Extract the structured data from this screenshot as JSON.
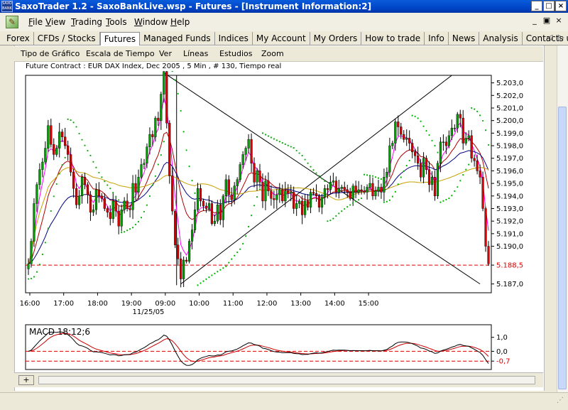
{
  "window": {
    "title": "SaxoTrader 1.2 - SaxoBankLive.wsp - Futures - [Instrument Information:2]",
    "app_icon_text": [
      "SAXO",
      "BANK"
    ],
    "controls": {
      "minimize": "_",
      "maximize": "□",
      "close": "×"
    }
  },
  "menubar": {
    "items": [
      {
        "label": "File",
        "accel": "F"
      },
      {
        "label": "View",
        "accel": "V"
      },
      {
        "label": "Trading",
        "accel": "T"
      },
      {
        "label": "Tools",
        "accel": "T"
      },
      {
        "label": "Window",
        "accel": "W"
      },
      {
        "label": "Help",
        "accel": "H"
      }
    ],
    "doc_controls": {
      "minimize": "_",
      "restore": "▣",
      "close": "×"
    }
  },
  "nav_tabs": [
    "Forex",
    "CFDs / Stocks",
    "Futures",
    "Managed Funds",
    "Indices",
    "My Account",
    "My Orders",
    "How to trade",
    "Info",
    "News",
    "Analysis",
    "Contacts us"
  ],
  "nav_active": "Futures",
  "nav_scroll": {
    "left": "◁",
    "right": "▷"
  },
  "chart_toolbar": [
    "Tipo de Gráfico",
    "Escala de Tiempo",
    "Ver",
    "Líneas",
    "Estudios",
    "Zoom"
  ],
  "chart_title": "Future Contract : EUR DAX Index, Dec 2005 , 5 Min , # 130, Tiempo real",
  "colors": {
    "bull": "#00A000",
    "bear": "#DD0000",
    "magenta": "#FF00FF",
    "red_ma": "#B00000",
    "blue_ma": "#000080",
    "gold_ma": "#C8A000",
    "sar": "#00B000",
    "ref_line": "#DD0000",
    "macd": "#000000",
    "signal": "#CC0000"
  },
  "chart_data": {
    "type": "candlestick",
    "price_axis": {
      "ticks": [
        "5.203,0",
        "5.202,0",
        "5.201,0",
        "5.200,0",
        "5.199,0",
        "5.198,0",
        "5.197,0",
        "5.196,0",
        "5.195,0",
        "5.194,0",
        "5.193,0",
        "5.192,0",
        "5.191,0",
        "5.190,0",
        "5.188,5",
        "5.187,0"
      ],
      "ylim": [
        5186.3,
        5203.6
      ],
      "reference_line": 5188.5
    },
    "time_axis": {
      "ticks": [
        "16:00",
        "17:00",
        "18:00",
        "19:00",
        "09:00",
        "10:00",
        "11:00",
        "12:00",
        "13:00",
        "14:00",
        "15:00"
      ],
      "date_label": "11/25/05"
    },
    "close_series": [
      5188.6,
      5190.4,
      5193.4,
      5194.9,
      5196.1,
      5196.7,
      5197.8,
      5199.6,
      5198.1,
      5197.3,
      5197.8,
      5199.1,
      5198.7,
      5198.0,
      5197.3,
      5195.9,
      5194.6,
      5193.3,
      5194.0,
      5195.5,
      5194.9,
      5194.1,
      5192.7,
      5192.9,
      5194.5,
      5194.0,
      5193.8,
      5193.0,
      5192.7,
      5192.2,
      5193.6,
      5192.8,
      5191.6,
      5192.9,
      5193.6,
      5193.0,
      5192.9,
      5195.0,
      5194.3,
      5195.5,
      5196.5,
      5196.6,
      5197.9,
      5198.9,
      5198.7,
      5200.2,
      5200.0,
      5202.1,
      5203.9,
      5199.8,
      5195.6,
      5192.8,
      5190.1,
      5189.0,
      5187.4,
      5188.9,
      5188.8,
      5190.4,
      5191.3,
      5192.9,
      5194.6,
      5193.6,
      5193.2,
      5193.0,
      5193.4,
      5191.8,
      5192.0,
      5193.3,
      5192.1,
      5194.0,
      5195.3,
      5194.1,
      5193.7,
      5194.8,
      5195.3,
      5196.5,
      5197.3,
      5197.8,
      5198.5,
      5196.6,
      5195.1,
      5196.0,
      5195.1,
      5193.6,
      5195.2,
      5194.4,
      5193.8,
      5193.7,
      5194.1,
      5194.5,
      5193.6,
      5194.4,
      5194.2,
      5194.3,
      5193.0,
      5193.4,
      5193.6,
      5192.5,
      5193.6,
      5193.1,
      5194.3,
      5194.2,
      5194.0,
      5193.1,
      5193.9,
      5194.6,
      5194.5,
      5195.1,
      5195.2,
      5194.3,
      5194.6,
      5194.7,
      5194.5,
      5194.3,
      5193.8,
      5194.8,
      5194.3,
      5194.5,
      5194.4,
      5194.3,
      5194.7,
      5195.0,
      5194.0,
      5194.4,
      5194.7,
      5194.3,
      5195.5,
      5195.9,
      5198.0,
      5198.2,
      5199.9,
      5199.5,
      5198.9,
      5198.5,
      5198.6,
      5198.2,
      5197.5,
      5197.2,
      5196.6,
      5195.5,
      5197.0,
      5196.1,
      5194.9,
      5195.5,
      5194.0,
      5196.6,
      5198.3,
      5198.3,
      5198.0,
      5198.8,
      5199.4,
      5199.4,
      5200.5,
      5200.2,
      5198.2,
      5198.6,
      5198.8,
      5197.0,
      5196.8,
      5196.0,
      5195.5,
      5193.0,
      5190.0,
      5188.6
    ],
    "moving_averages": [
      "magenta",
      "red",
      "blue",
      "gold"
    ],
    "overlays": [
      "parabolic-sar",
      "trendlines"
    ]
  },
  "macd_data": {
    "title": "MACD 18;12;6",
    "ticks": [
      "1,0",
      "0,0",
      "-0,7"
    ],
    "ylim": [
      -1.3,
      1.9
    ],
    "ref_lines": [
      0.0,
      -0.7
    ]
  },
  "statusbar": {
    "cross_icon": "+"
  }
}
